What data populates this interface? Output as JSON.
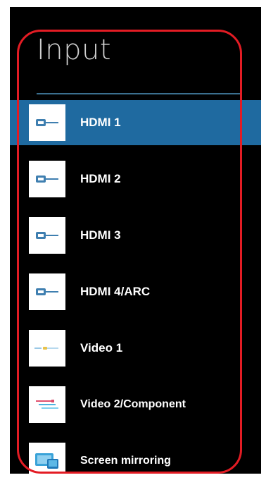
{
  "page": {
    "title": "Input"
  },
  "inputs": [
    {
      "label": "HDMI 1",
      "icon": "hdmi-icon",
      "selected": true
    },
    {
      "label": "HDMI 2",
      "icon": "hdmi-icon",
      "selected": false
    },
    {
      "label": "HDMI 3",
      "icon": "hdmi-icon",
      "selected": false
    },
    {
      "label": "HDMI 4/ARC",
      "icon": "hdmi-icon",
      "selected": false
    },
    {
      "label": "Video 1",
      "icon": "composite-video-icon",
      "selected": false
    },
    {
      "label": "Video 2/Component",
      "icon": "component-video-icon",
      "selected": false
    },
    {
      "label": "Screen mirroring",
      "icon": "screen-mirroring-icon",
      "selected": false
    }
  ],
  "colors": {
    "selection": "#1f6aa0",
    "highlight_frame": "#e31c24",
    "background": "#000000"
  }
}
